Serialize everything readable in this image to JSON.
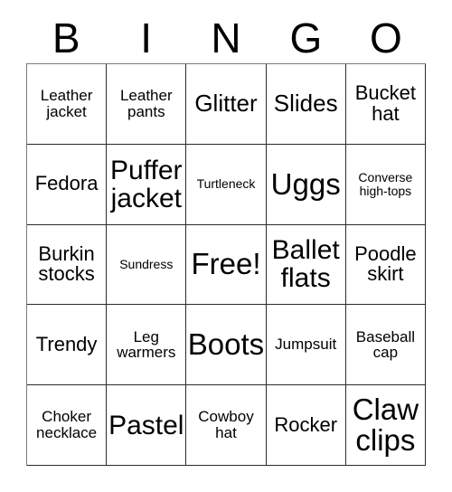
{
  "card": {
    "title_letters": [
      "B",
      "I",
      "N",
      "G",
      "O"
    ],
    "free_space_label": "Free!",
    "colors": {
      "background": "#ffffff",
      "cell_background": "#ffffff",
      "grid_line": "#2b2b2b",
      "text": "#000000"
    },
    "grid_size": "5x5",
    "rows": [
      [
        {
          "text": "Leather\njacket",
          "size": "sm"
        },
        {
          "text": "Leather\npants",
          "size": "sm"
        },
        {
          "text": "Glitter",
          "size": "lg"
        },
        {
          "text": "Slides",
          "size": "lg"
        },
        {
          "text": "Bucket\nhat",
          "size": "md"
        }
      ],
      [
        {
          "text": "Fedora",
          "size": "md"
        },
        {
          "text": "Puffer\njacket",
          "size": "xl"
        },
        {
          "text": "Turtleneck",
          "size": "xs"
        },
        {
          "text": "Uggs",
          "size": "xxl"
        },
        {
          "text": "Converse\nhigh-tops",
          "size": "xs"
        }
      ],
      [
        {
          "text": "Burkin\nstocks",
          "size": "md"
        },
        {
          "text": "Sundress",
          "size": "xs"
        },
        {
          "text": "Free!",
          "size": "xxl"
        },
        {
          "text": "Ballet\nflats",
          "size": "xl"
        },
        {
          "text": "Poodle\nskirt",
          "size": "md"
        }
      ],
      [
        {
          "text": "Trendy",
          "size": "md"
        },
        {
          "text": "Leg\nwarmers",
          "size": "sm"
        },
        {
          "text": "Boots",
          "size": "xxl"
        },
        {
          "text": "Jumpsuit",
          "size": "sm"
        },
        {
          "text": "Baseball\ncap",
          "size": "sm"
        }
      ],
      [
        {
          "text": "Choker\nnecklace",
          "size": "sm"
        },
        {
          "text": "Pastel",
          "size": "xl"
        },
        {
          "text": "Cowboy\nhat",
          "size": "sm"
        },
        {
          "text": "Rocker",
          "size": "md"
        },
        {
          "text": "Claw\nclips",
          "size": "xxl"
        }
      ]
    ]
  }
}
